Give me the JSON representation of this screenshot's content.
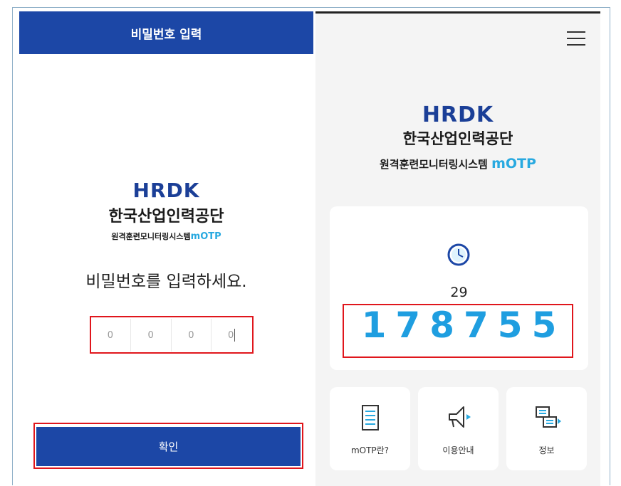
{
  "left": {
    "header_title": "비밀번호 입력",
    "logo": {
      "brand": "HRDK",
      "org": "한국산업인력공단",
      "system": "원격훈련모니터링시스템",
      "system_suffix": "mOTP"
    },
    "prompt": "비밀번호를 입력하세요.",
    "pin_placeholders": [
      "0",
      "0",
      "0",
      "0"
    ],
    "confirm_label": "확인"
  },
  "right": {
    "logo": {
      "brand": "HRDK",
      "org": "한국산업인력공단",
      "system": "원격훈련모니터링시스템",
      "system_suffix": "mOTP"
    },
    "timer_seconds": "29",
    "otp_code": "178755",
    "tiles": [
      {
        "label": "mOTP란?",
        "icon": "document-icon"
      },
      {
        "label": "이용안내",
        "icon": "megaphone-icon"
      },
      {
        "label": "정보",
        "icon": "chat-bubbles-icon"
      }
    ]
  },
  "colors": {
    "primary": "#1c47a6",
    "accent": "#28a9e0",
    "otp": "#1f9ee0",
    "highlight": "#e0161c"
  }
}
